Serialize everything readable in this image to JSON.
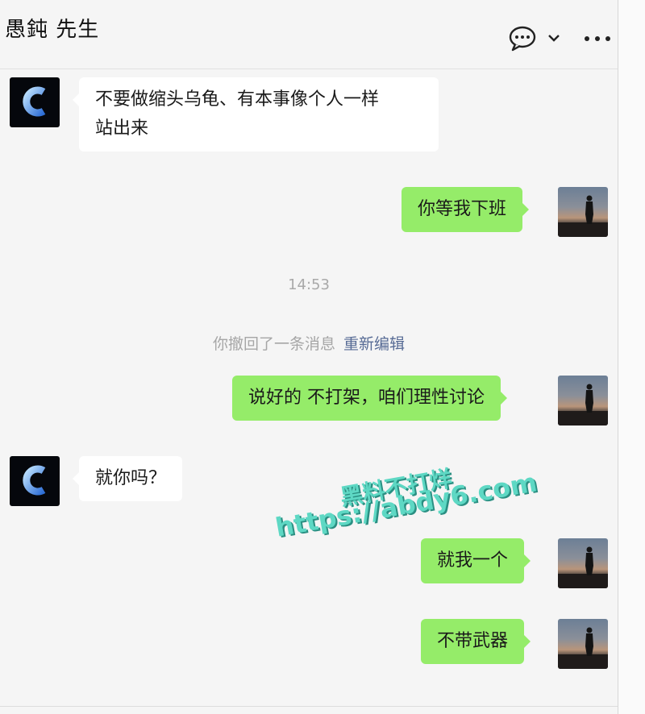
{
  "header": {
    "title": "愚鈍 先生",
    "icons": [
      "chat-bubble-icon",
      "chevron-down-icon",
      "more-icon"
    ]
  },
  "messages": [
    {
      "side": "left",
      "text_lines": [
        "不要做缩头乌龟、有本事像个人一样",
        "站出来"
      ]
    },
    {
      "side": "right",
      "text": "你等我下班"
    },
    {
      "type": "time",
      "text": "14:53"
    },
    {
      "type": "recall",
      "text": "你撤回了一条消息",
      "link": "重新编辑"
    },
    {
      "side": "right",
      "text": "说好的 不打架，咱们理性讨论"
    },
    {
      "side": "left",
      "text": "就你吗？"
    },
    {
      "side": "right",
      "text": "就我一个"
    },
    {
      "side": "right",
      "text": "不带武器"
    }
  ],
  "watermark": {
    "line1": "黑料不打烊",
    "line2": "https://abdy6.com"
  },
  "colors": {
    "background": "#f5f5f5",
    "bubble_self": "#95ec69",
    "bubble_other": "#ffffff",
    "link": "#576b95",
    "watermark": "#5ed8c4"
  }
}
